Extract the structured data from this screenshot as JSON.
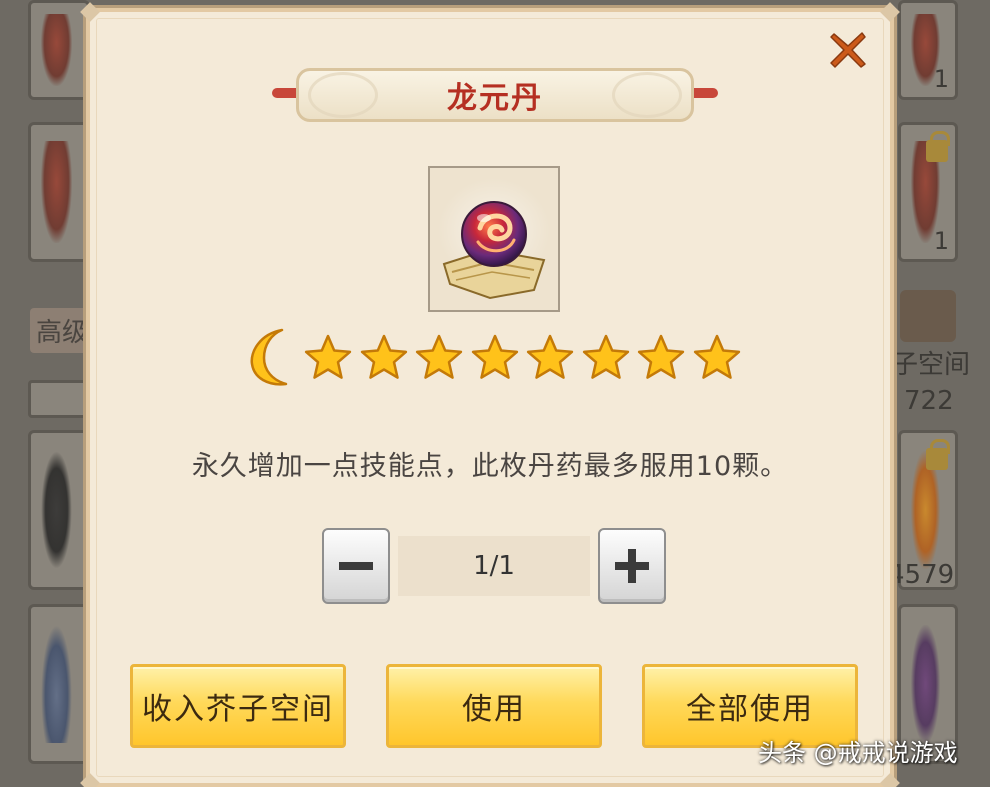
{
  "dialog": {
    "title": "龙元丹",
    "close_icon": "close-x-icon",
    "item_icon": "dragon-orb-pill-icon",
    "grade": {
      "moons": 1,
      "stars": 8
    },
    "description": "永久增加一点技能点，此枚丹药最多服用10颗。",
    "quantity": {
      "display": "1/1",
      "minus_icon": "minus-icon",
      "plus_icon": "plus-icon"
    },
    "buttons": {
      "store_label": "收入芥子空间",
      "use_label": "使用",
      "use_all_label": "全部使用"
    }
  },
  "background": {
    "tab_label": "高级",
    "space_label": "子空间",
    "count_a": "1",
    "count_b": "1",
    "count_c": "722",
    "count_d": "4579"
  },
  "watermark": "头条 @戒戒说游戏",
  "colors": {
    "title_red": "#b52f22",
    "button_gold": "#ffd95a",
    "close_orange": "#cc5a1a",
    "star_yellow": "#ffc21a",
    "dialog_bg": "#f4ead8"
  }
}
